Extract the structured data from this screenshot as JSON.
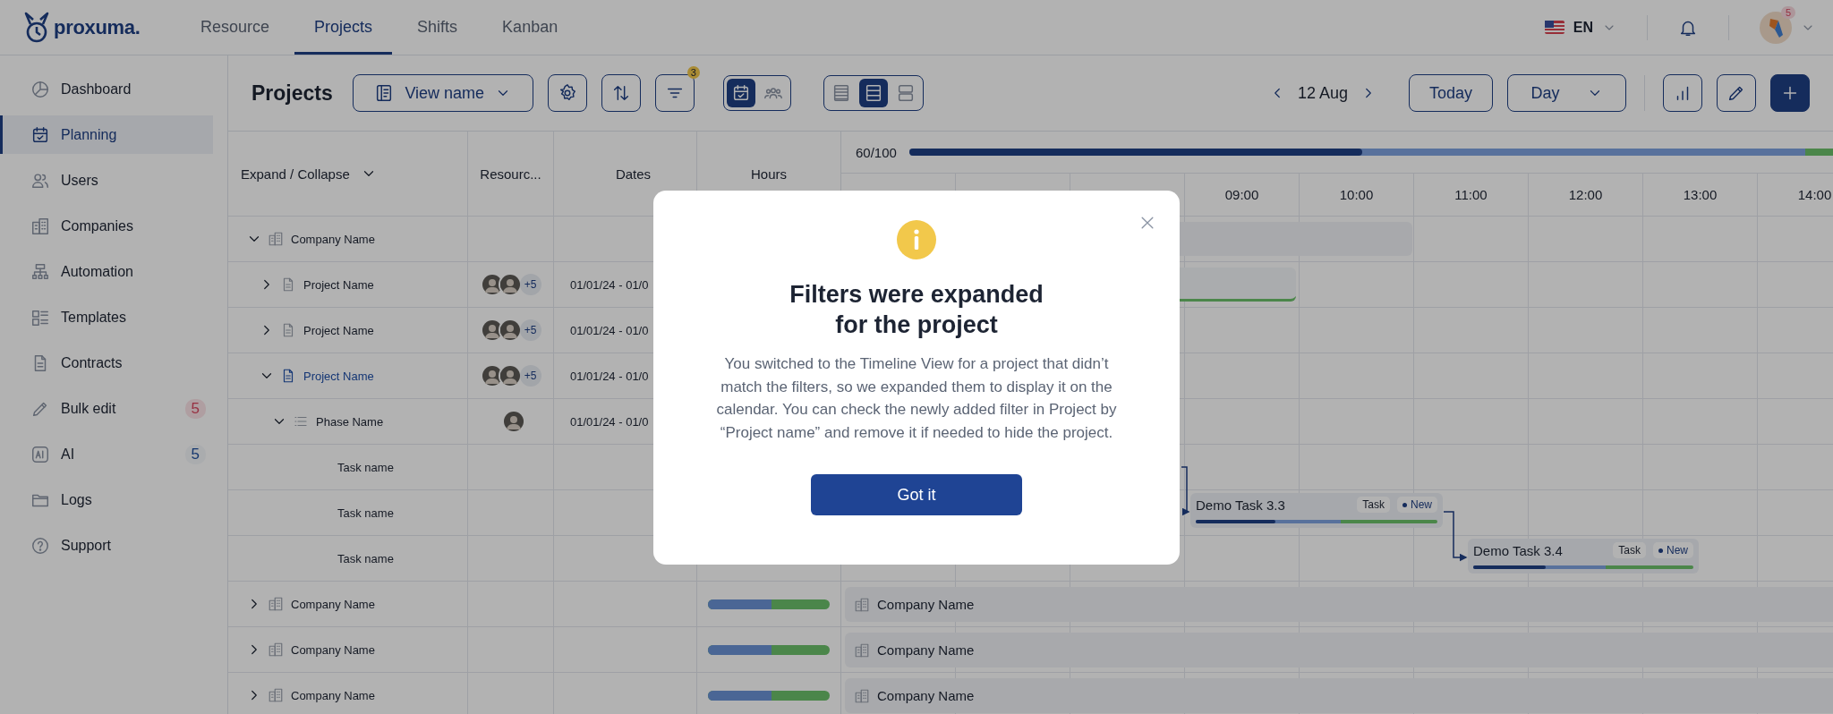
{
  "brand": {
    "name": "proxuma."
  },
  "nav_tabs": [
    {
      "label": "Resource",
      "selected": false
    },
    {
      "label": "Projects",
      "selected": true
    },
    {
      "label": "Shifts",
      "selected": false
    },
    {
      "label": "Kanban",
      "selected": false
    }
  ],
  "language": {
    "code": "EN"
  },
  "user": {
    "badge": "5"
  },
  "sidebar": {
    "items": [
      {
        "label": "Dashboard",
        "selected": false
      },
      {
        "label": "Planning",
        "selected": true
      },
      {
        "label": "Users",
        "selected": false
      },
      {
        "label": "Companies",
        "selected": false
      },
      {
        "label": "Automation",
        "selected": false
      },
      {
        "label": "Templates",
        "selected": false
      },
      {
        "label": "Contracts",
        "selected": false
      },
      {
        "label": "Bulk edit",
        "selected": false,
        "badge": {
          "text": "5",
          "kind": "alert"
        }
      },
      {
        "label": "AI",
        "selected": false,
        "badge": {
          "text": "5",
          "kind": "info"
        }
      },
      {
        "label": "Logs",
        "selected": false
      },
      {
        "label": "Support",
        "selected": false
      }
    ]
  },
  "toolbar": {
    "title": "Projects",
    "view_select": {
      "value": "View name"
    },
    "filter_badge": "3",
    "mode_toggle": [
      {
        "selected": true
      },
      {
        "selected": false
      }
    ],
    "density_toggle": [
      {
        "selected": false
      },
      {
        "selected": true
      },
      {
        "selected": false
      }
    ],
    "date_nav": {
      "label": "12 Aug"
    },
    "today_button": "Today",
    "scale_select": {
      "value": "Day"
    }
  },
  "table": {
    "columns": [
      {
        "label": "Expand / Collapse"
      },
      {
        "label": "Resourc..."
      },
      {
        "label": "Dates"
      },
      {
        "label": "Hours"
      }
    ],
    "rows": [
      {
        "kind": "company",
        "name": "Company Name",
        "expanded": true,
        "selected": false,
        "bar": {
          "kind": "summary"
        },
        "children": [
          {
            "kind": "project",
            "name": "Project Name",
            "expanded": false,
            "selected": false,
            "resources": [
              {
                "kind": "avatar"
              },
              {
                "kind": "avatar"
              },
              {
                "kind": "more",
                "text": "+5"
              }
            ],
            "dates": "01/01/24 - 01/0",
            "bar": {
              "kind": "project"
            }
          },
          {
            "kind": "project",
            "name": "Project Name",
            "expanded": false,
            "selected": false,
            "resources": [
              {
                "kind": "avatar"
              },
              {
                "kind": "avatar"
              },
              {
                "kind": "more",
                "text": "+5"
              }
            ],
            "dates": "01/01/24 - 01/0"
          },
          {
            "kind": "project",
            "name": "Project Name",
            "expanded": true,
            "selected": true,
            "resources": [
              {
                "kind": "avatar"
              },
              {
                "kind": "avatar"
              },
              {
                "kind": "more",
                "text": "+5"
              }
            ],
            "dates": "01/01/24 - 01/0",
            "children": [
              {
                "kind": "phase",
                "name": "Phase Name",
                "expanded": true,
                "selected": false,
                "resources": [
                  {
                    "kind": "avatar"
                  }
                ],
                "dates": "01/01/24 - 01/0",
                "children": [
                  {
                    "kind": "task",
                    "name": "Task name",
                    "selected": false
                  },
                  {
                    "kind": "task",
                    "name": "Task name",
                    "selected": false,
                    "bar": {
                      "kind": "task",
                      "label": "Demo Task 3.3",
                      "tag": "Task",
                      "status": "New",
                      "level": 0.33
                    }
                  },
                  {
                    "kind": "task",
                    "name": "Task name",
                    "selected": false,
                    "bar": {
                      "kind": "task",
                      "label": "Demo Task 3.4",
                      "tag": "Task",
                      "status": "New",
                      "level": 0.33
                    }
                  }
                ]
              }
            ]
          }
        ]
      },
      {
        "kind": "company",
        "name": "Company Name",
        "expanded": false,
        "selected": false,
        "hours": {
          "level": 0.52
        },
        "bar": {
          "kind": "band",
          "label": "Company Name"
        }
      },
      {
        "kind": "company",
        "name": "Company Name",
        "expanded": false,
        "selected": false,
        "hours": {
          "level": 0.52
        },
        "bar": {
          "kind": "band",
          "label": "Company Name"
        }
      },
      {
        "kind": "company",
        "name": "Company Name",
        "expanded": false,
        "selected": false,
        "hours": {
          "level": 0.52
        },
        "bar": {
          "kind": "band",
          "label": "Company Name"
        }
      }
    ]
  },
  "timeline": {
    "capacity": {
      "reading": "60/100",
      "level": 0.49
    },
    "hours": [
      "09:00",
      "10:00",
      "11:00",
      "12:00",
      "13:00",
      "14:00"
    ]
  },
  "modal": {
    "title": "Filters were expanded for the project",
    "body": "You switched to the Timeline View for a project that didn’t match the filters, so we expanded them to display it on the calendar. You can check the newly added filter in Project by “Project name” and remove it if needed to hide the project.",
    "button": "Got it"
  }
}
